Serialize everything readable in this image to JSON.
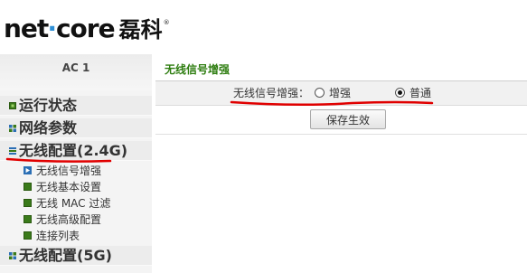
{
  "header": {
    "logo_main_1": "net",
    "logo_dot": "·",
    "logo_main_2": "core",
    "logo_cn": "磊科",
    "logo_reg": "®"
  },
  "sidebar": {
    "title": "AC 1",
    "menu": [
      {
        "label": "运行状态"
      },
      {
        "label": "网络参数"
      },
      {
        "label": "无线配置(2.4G)"
      },
      {
        "label": "无线配置(5G)"
      }
    ],
    "submenu": [
      {
        "label": "无线信号增强"
      },
      {
        "label": "无线基本设置"
      },
      {
        "label": "无线 MAC 过滤"
      },
      {
        "label": "无线高级配置"
      },
      {
        "label": "连接列表"
      }
    ]
  },
  "main": {
    "section_title": "无线信号增强",
    "field_label": "无线信号增强：",
    "options": [
      {
        "label": "增强",
        "selected": false
      },
      {
        "label": "普通",
        "selected": true
      }
    ],
    "save_label": "保存生效"
  },
  "colors": {
    "accent_green": "#2e7d10",
    "annotation_red": "#e00000",
    "logo_blue": "#2e8fd6"
  }
}
